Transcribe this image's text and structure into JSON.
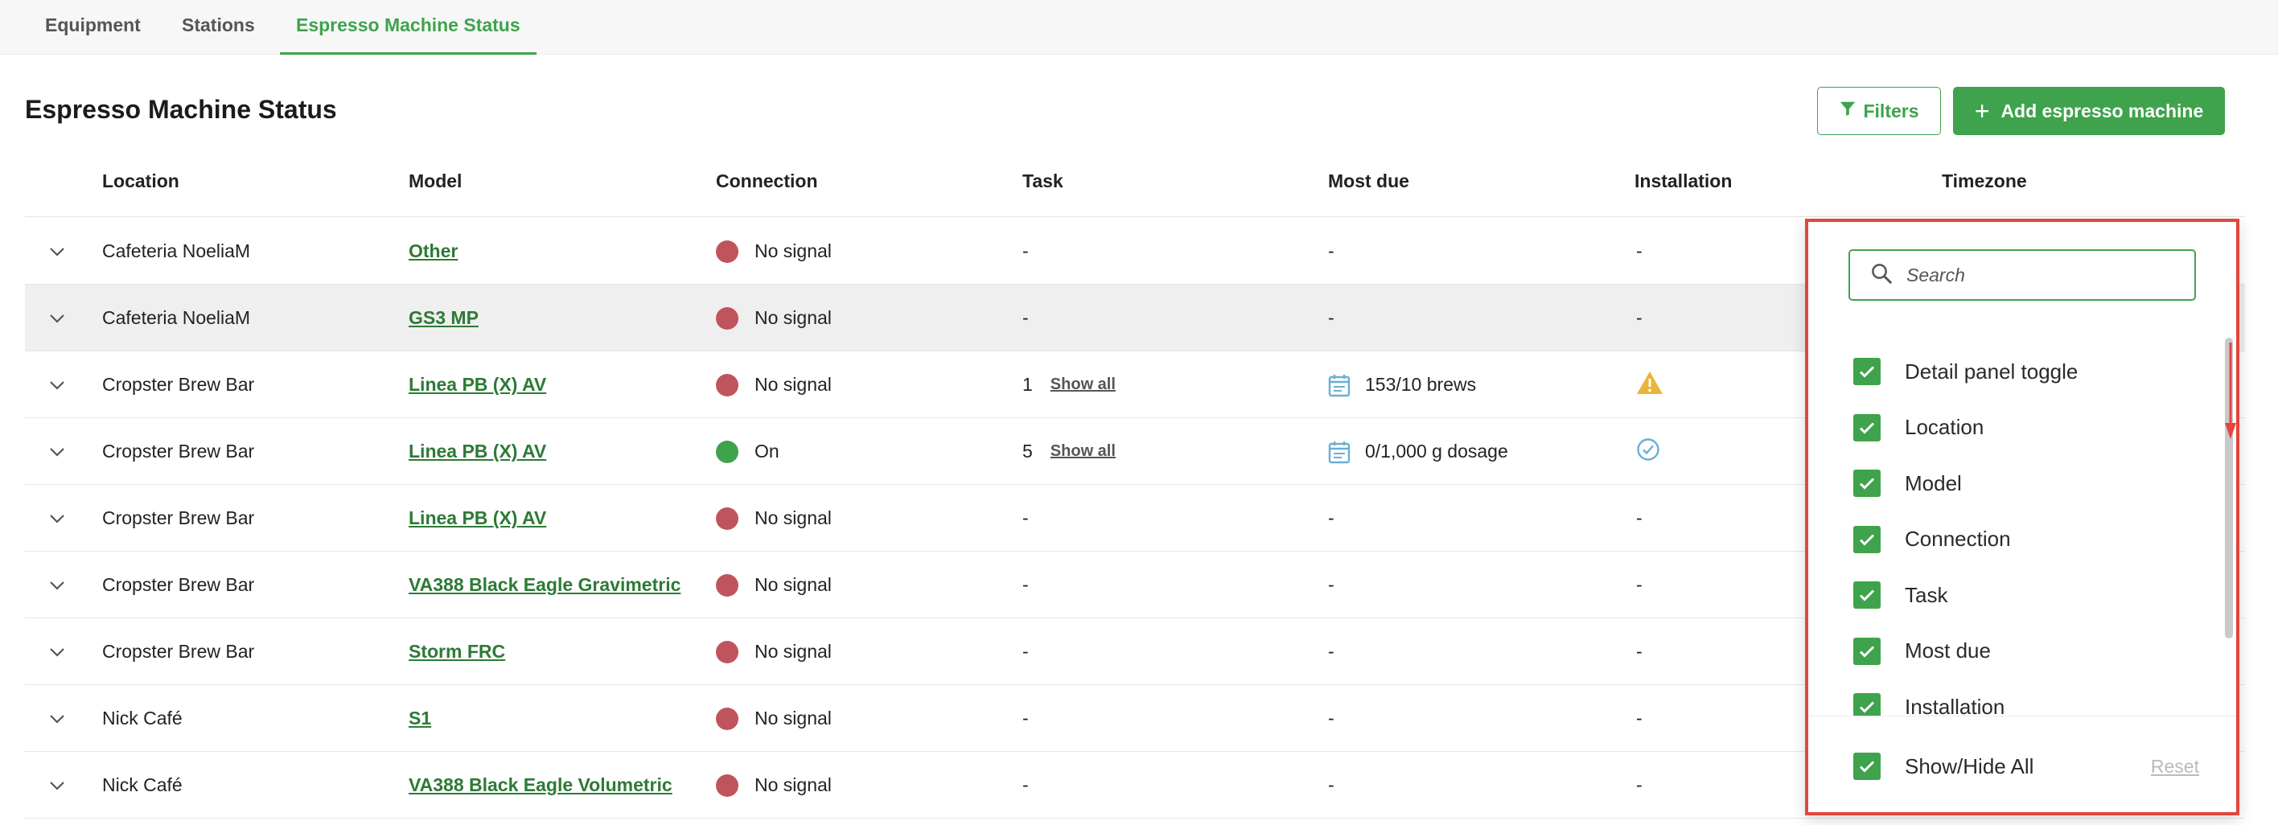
{
  "tabs": [
    {
      "label": "Equipment",
      "active": false
    },
    {
      "label": "Stations",
      "active": false
    },
    {
      "label": "Espresso Machine Status",
      "active": true
    }
  ],
  "page_title": "Espresso Machine Status",
  "toolbar": {
    "filters_label": "Filters",
    "add_label": "Add espresso machine"
  },
  "columns": [
    "Location",
    "Model",
    "Connection",
    "Task",
    "Most due",
    "Installation",
    "Timezone"
  ],
  "rows": [
    {
      "location": "Cafeteria NoeliaM",
      "model": "Other",
      "connection": "No signal",
      "status": "red",
      "task": "-",
      "most_due": "-",
      "installation": "-"
    },
    {
      "location": "Cafeteria NoeliaM",
      "model": "GS3 MP",
      "connection": "No signal",
      "status": "red",
      "task": "-",
      "most_due": "-",
      "installation": "-"
    },
    {
      "location": "Cropster Brew Bar",
      "model": "Linea PB (X) AV",
      "connection": "No signal",
      "status": "red",
      "task": "1",
      "show_all": "Show all",
      "most_due": "153/10 brews",
      "installation": "warning-icon"
    },
    {
      "location": "Cropster Brew Bar",
      "model": "Linea PB (X) AV",
      "connection": "On",
      "status": "green",
      "task": "5",
      "show_all": "Show all",
      "most_due": "0/1,000 g dosage",
      "installation": "check-circle-icon"
    },
    {
      "location": "Cropster Brew Bar",
      "model": "Linea PB (X) AV",
      "connection": "No signal",
      "status": "red",
      "task": "-",
      "most_due": "-",
      "installation": "-"
    },
    {
      "location": "Cropster Brew Bar",
      "model": "VA388 Black Eagle Gravimetric",
      "connection": "No signal",
      "status": "red",
      "task": "-",
      "most_due": "-",
      "installation": "-"
    },
    {
      "location": "Cropster Brew Bar",
      "model": "Storm FRC",
      "connection": "No signal",
      "status": "red",
      "task": "-",
      "most_due": "-",
      "installation": "-"
    },
    {
      "location": "Nick Café",
      "model": "S1",
      "connection": "No signal",
      "status": "red",
      "task": "-",
      "most_due": "-",
      "installation": "-"
    },
    {
      "location": "Nick Café",
      "model": "VA388 Black Eagle Volumetric",
      "connection": "No signal",
      "status": "red",
      "task": "-",
      "most_due": "-",
      "installation": "-"
    }
  ],
  "column_panel": {
    "search_placeholder": "Search",
    "options": [
      {
        "label": "Detail panel toggle",
        "checked": true
      },
      {
        "label": "Location",
        "checked": true
      },
      {
        "label": "Model",
        "checked": true
      },
      {
        "label": "Connection",
        "checked": true
      },
      {
        "label": "Task",
        "checked": true
      },
      {
        "label": "Most due",
        "checked": true
      },
      {
        "label": "Installation",
        "checked": true
      }
    ],
    "show_hide_all_label": "Show/Hide All",
    "reset_label": "Reset"
  },
  "colors": {
    "accent": "#3ea34c",
    "status_red": "#c0545c",
    "status_green": "#3ea34c",
    "highlight_border": "#e2463c",
    "warning": "#e9b53a",
    "info_blue": "#6aaed6"
  }
}
